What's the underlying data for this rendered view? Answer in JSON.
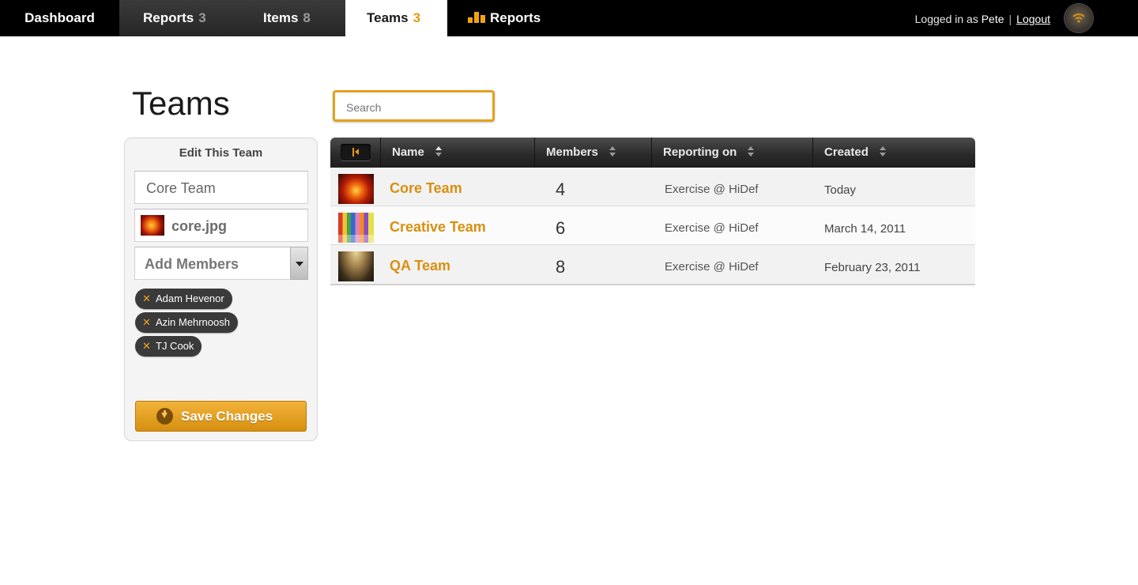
{
  "nav": {
    "tabs": [
      {
        "label": "Dashboard",
        "count": ""
      },
      {
        "label": "Reports",
        "count": "3"
      },
      {
        "label": "Items",
        "count": "8"
      },
      {
        "label": "Teams",
        "count": "3"
      }
    ],
    "reports_link": "Reports",
    "logged_in_prefix": "Logged in as",
    "username": "Pete",
    "separator": "|",
    "logout": "Logout"
  },
  "page": {
    "title": "Teams",
    "search_placeholder": "Search"
  },
  "edit_panel": {
    "title": "Edit This Team",
    "team_name_value": "Core Team",
    "image_file": "core.jpg",
    "members_placeholder": "Add Members",
    "members": [
      "Adam Hevenor",
      "Azin Mehrnoosh",
      "TJ Cook"
    ],
    "remove_glyph": "✕",
    "save_label": "Save Changes"
  },
  "table": {
    "columns": [
      "Name",
      "Members",
      "Reporting on",
      "Created"
    ],
    "rows": [
      {
        "name": "Core Team",
        "members": "4",
        "reporting_on": "Exercise @ HiDef",
        "created": "Today"
      },
      {
        "name": "Creative Team",
        "members": "6",
        "reporting_on": "Exercise @ HiDef",
        "created": "March 14, 2011"
      },
      {
        "name": "QA Team",
        "members": "8",
        "reporting_on": "Exercise @ HiDef",
        "created": "February 23, 2011"
      }
    ]
  },
  "colors": {
    "accent": "#e39a12",
    "nav_bg": "#000000",
    "link": "#d9900f"
  }
}
